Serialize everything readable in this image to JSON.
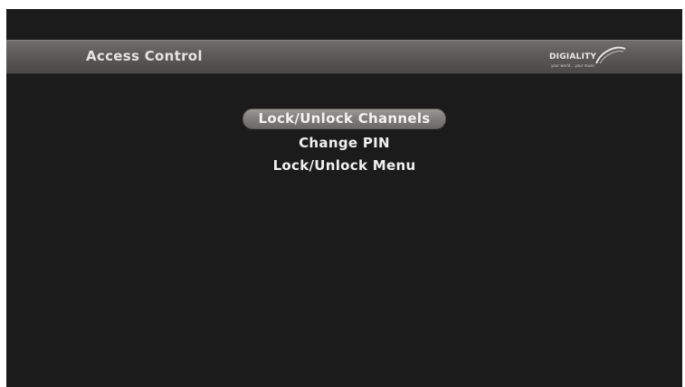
{
  "header": {
    "title": "Access Control",
    "logo": {
      "brand": "DIGIALITY",
      "tagline": "your world... your music"
    }
  },
  "menu": {
    "items": [
      {
        "label": "Lock/Unlock Channels",
        "selected": true
      },
      {
        "label": "Change PIN",
        "selected": false
      },
      {
        "label": "Lock/Unlock Menu",
        "selected": false
      }
    ]
  },
  "colors": {
    "background": "#1c1b1b",
    "header_bar": "#5b5a58",
    "highlight": "#8a8987",
    "text": "#f0f0f0"
  }
}
